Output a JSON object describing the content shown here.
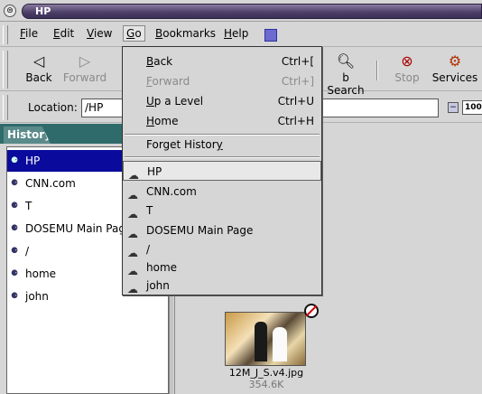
{
  "window": {
    "title": "HP"
  },
  "menubar": {
    "items": [
      {
        "label": "File",
        "u": "F",
        "rest": "ile"
      },
      {
        "label": "Edit",
        "u": "E",
        "rest": "dit"
      },
      {
        "label": "View",
        "u": "V",
        "rest": "iew"
      },
      {
        "label": "Go",
        "u": "G",
        "rest": "o"
      },
      {
        "label": "Bookmarks",
        "u": "B",
        "rest": "ookmarks"
      },
      {
        "label": "Help",
        "u": "H",
        "rest": "elp"
      }
    ]
  },
  "toolbar": {
    "back": "Back",
    "forward": "Forward",
    "search_partial": "b Search",
    "stop": "Stop",
    "services": "Services"
  },
  "location": {
    "label": "Location:",
    "value": "/HP",
    "zoom": "100"
  },
  "sidebar": {
    "tab": "History",
    "items": [
      "HP",
      "CNN.com",
      "T",
      "DOSEMU Main Page",
      "/",
      "home",
      "john"
    ]
  },
  "go_menu": {
    "back": {
      "u": "B",
      "rest": "ack",
      "accel": "Ctrl+["
    },
    "forward": {
      "u": "F",
      "rest": "orward",
      "accel": "Ctrl+]"
    },
    "up": {
      "u": "U",
      "rest": "p a Level",
      "accel": "Ctrl+U"
    },
    "home": {
      "u": "H",
      "rest": "ome",
      "accel": "Ctrl+H"
    },
    "forget": {
      "u": "",
      "pre": "Forget Histor",
      "post": "y"
    },
    "history": [
      "HP",
      "CNN.com",
      "T",
      "DOSEMU Main Page",
      "/",
      "home",
      "john"
    ]
  },
  "file": {
    "name": "12M_J_S.v4.jpg",
    "size": "354.6K"
  }
}
